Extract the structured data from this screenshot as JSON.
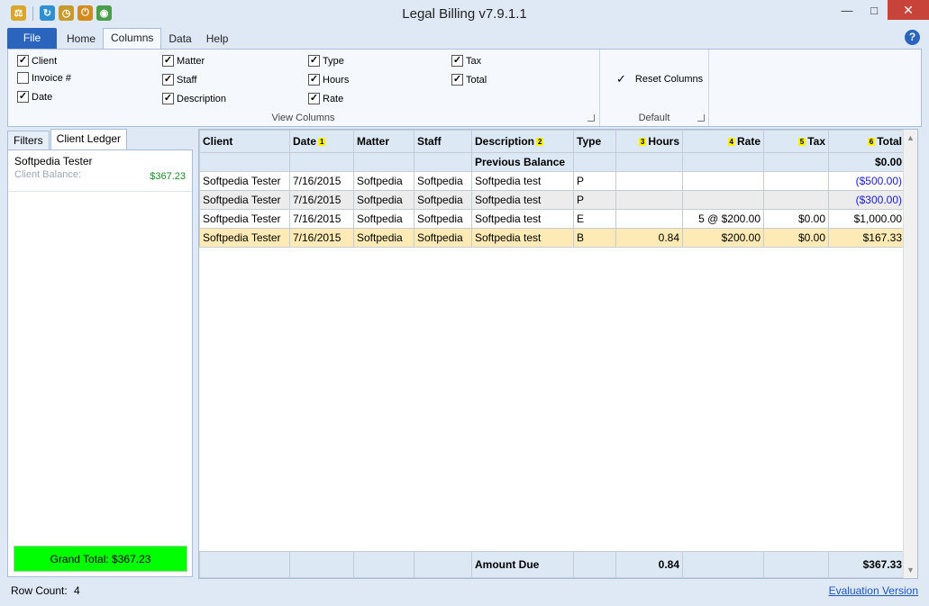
{
  "window": {
    "title": "Legal Billing v7.9.1.1",
    "minimize": "—",
    "maximize": "□",
    "close": "✕"
  },
  "colors": {
    "file_tab": "#2a64bd",
    "grand_total_bg": "#00ff00",
    "balance_green": "#1d8a2a",
    "negative_blue": "#1a1acf",
    "selected_row": "#fdeab4"
  },
  "ribbon": {
    "tabs": [
      "File",
      "Home",
      "Columns",
      "Data",
      "Help"
    ],
    "active_tab": "Columns",
    "help_glyph": "?",
    "view_columns": {
      "label": "View Columns",
      "checkboxes": [
        {
          "label": "Client",
          "checked": true
        },
        {
          "label": "Invoice #",
          "checked": false
        },
        {
          "label": "Date",
          "checked": true
        },
        {
          "label": "Matter",
          "checked": true
        },
        {
          "label": "Staff",
          "checked": true
        },
        {
          "label": "Description",
          "checked": true
        },
        {
          "label": "Type",
          "checked": true
        },
        {
          "label": "Hours",
          "checked": true
        },
        {
          "label": "Rate",
          "checked": true
        },
        {
          "label": "Tax",
          "checked": true
        },
        {
          "label": "Total",
          "checked": true
        }
      ]
    },
    "default_group": {
      "label": "Default",
      "reset_glyph": "✓",
      "reset_label": "Reset Columns"
    }
  },
  "left_panel": {
    "tabs": [
      "Filters",
      "Client Ledger"
    ],
    "active_tab": "Client Ledger",
    "client_name": "Softpedia Tester",
    "balance_label": "Client Balance:",
    "balance_value": "$367.23",
    "grand_total": "Grand Total: $367.23"
  },
  "grid": {
    "columns": [
      {
        "label": "Client",
        "sort": ""
      },
      {
        "label": "Date",
        "sort": "1"
      },
      {
        "label": "Matter",
        "sort": ""
      },
      {
        "label": "Staff",
        "sort": ""
      },
      {
        "label": "Description",
        "sort": "2"
      },
      {
        "label": "Type",
        "sort": ""
      },
      {
        "label": "Hours",
        "sort": "3"
      },
      {
        "label": "Rate",
        "sort": "4"
      },
      {
        "label": "Tax",
        "sort": "5"
      },
      {
        "label": "Total",
        "sort": "6"
      }
    ],
    "previous_balance": {
      "label": "Previous Balance",
      "total": "$0.00"
    },
    "rows": [
      {
        "client": "Softpedia Tester",
        "date": "7/16/2015",
        "matter": "Softpedia",
        "staff": "Softpedia",
        "description": "Softpedia test",
        "type": "P",
        "hours": "",
        "rate": "",
        "tax": "",
        "total": "($500.00)",
        "style": "white",
        "negative": true
      },
      {
        "client": "Softpedia Tester",
        "date": "7/16/2015",
        "matter": "Softpedia",
        "staff": "Softpedia",
        "description": "Softpedia test",
        "type": "P",
        "hours": "",
        "rate": "",
        "tax": "",
        "total": "($300.00)",
        "style": "gray",
        "negative": true
      },
      {
        "client": "Softpedia Tester",
        "date": "7/16/2015",
        "matter": "Softpedia",
        "staff": "Softpedia",
        "description": "Softpedia test",
        "type": "E",
        "hours": "",
        "rate": "5 @ $200.00",
        "tax": "$0.00",
        "total": "$1,000.00",
        "style": "white",
        "negative": false
      },
      {
        "client": "Softpedia Tester",
        "date": "7/16/2015",
        "matter": "Softpedia",
        "staff": "Softpedia",
        "description": "Softpedia test",
        "type": "B",
        "hours": "0.84",
        "rate": "$200.00",
        "tax": "$0.00",
        "total": "$167.33",
        "style": "sel",
        "negative": false
      }
    ],
    "footer": {
      "label": "Amount Due",
      "hours": "0.84",
      "total": "$367.33"
    }
  },
  "status": {
    "row_count_label": "Row Count:",
    "row_count": "4",
    "eval_link": "Evaluation Version"
  }
}
